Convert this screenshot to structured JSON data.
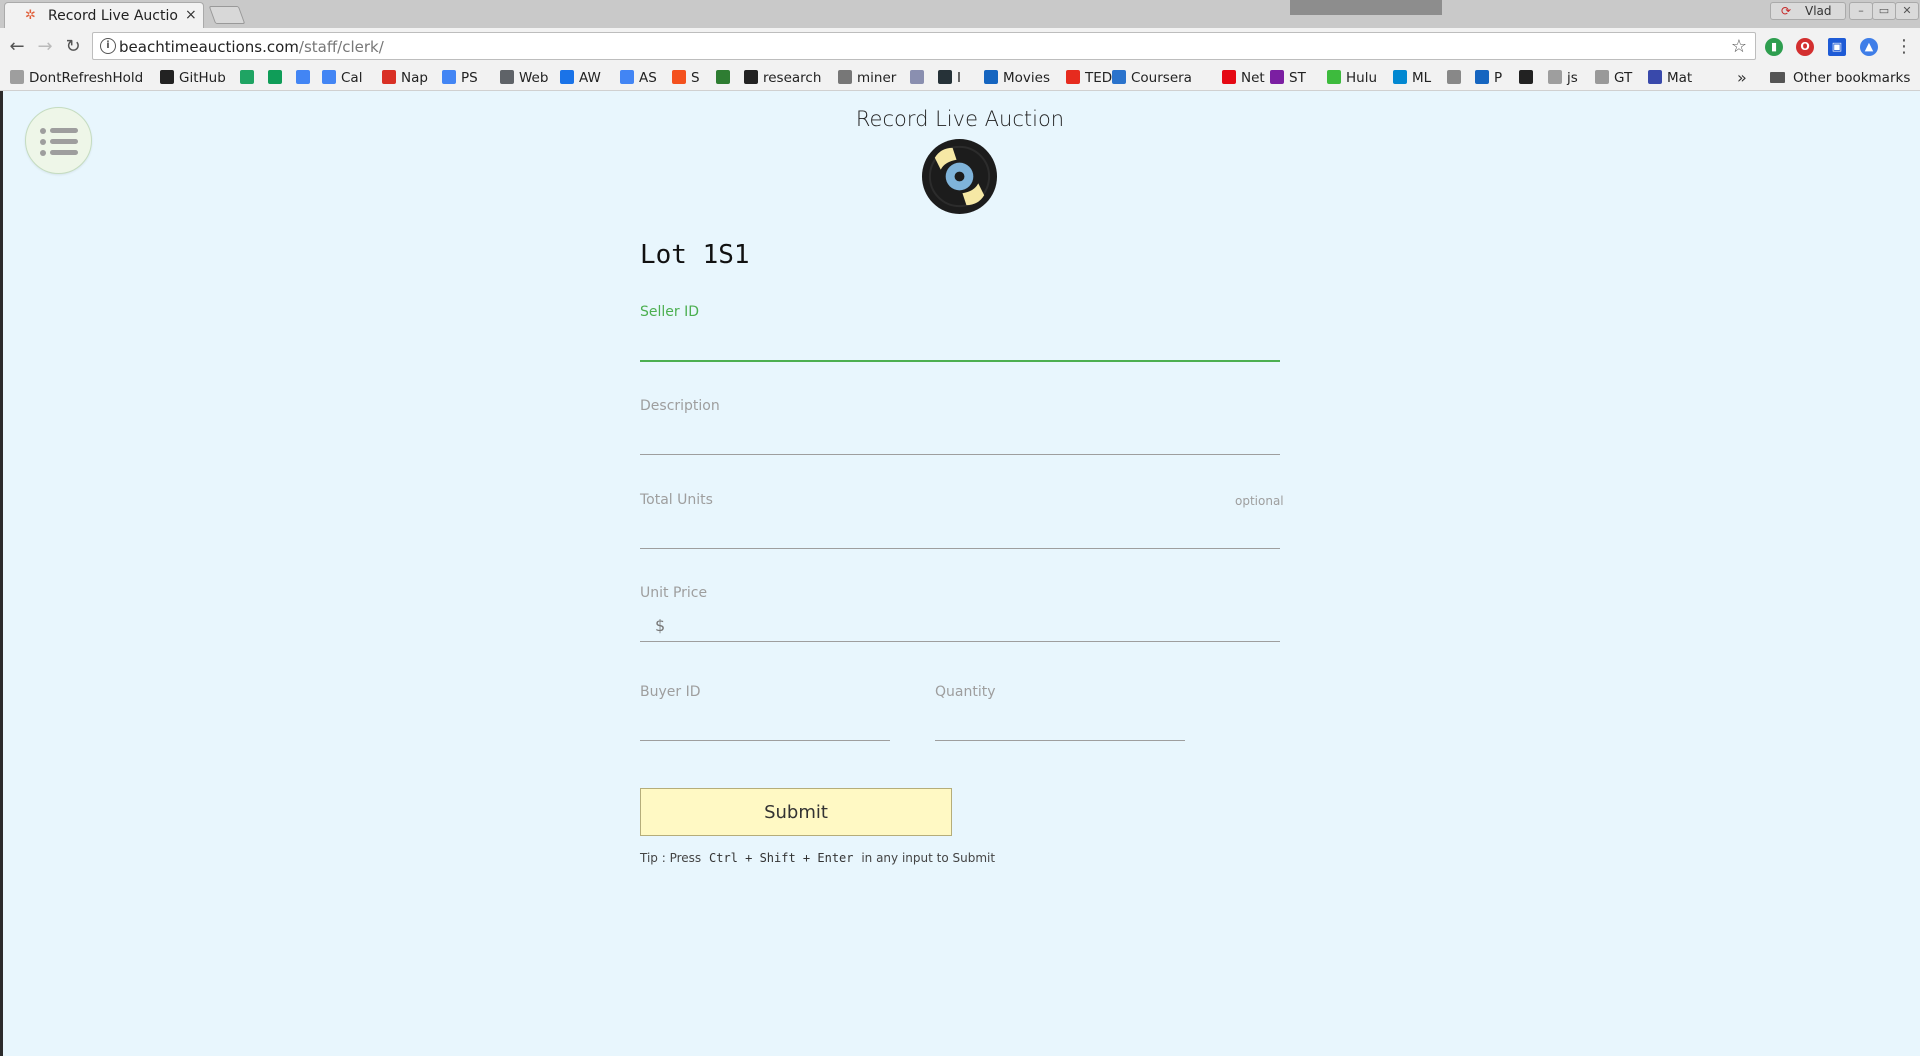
{
  "browser": {
    "tab_title": "Record Live Auction",
    "tab_close": "×",
    "user_name": "Vlad",
    "url_host": "beachtimeauctions.com",
    "url_path": "/staff/clerk/",
    "bookmarks": [
      {
        "label": "DontRefreshHold",
        "icon": "page-icon"
      },
      {
        "label": "GitHub",
        "icon": "github-icon"
      },
      {
        "label": "",
        "icon": "google-drive-icon"
      },
      {
        "label": "",
        "icon": "google-sheets-icon"
      },
      {
        "label": "",
        "icon": "google-docs-icon"
      },
      {
        "label": "Cal",
        "icon": "calendar-icon"
      },
      {
        "label": "Nap",
        "icon": "gmail-icon"
      },
      {
        "label": "PS",
        "icon": "google-icon"
      },
      {
        "label": "Web",
        "icon": "web-icon"
      },
      {
        "label": "AW",
        "icon": "adwords-icon"
      },
      {
        "label": "AS",
        "icon": "google-icon"
      },
      {
        "label": "S",
        "icon": "orange-circle-icon"
      },
      {
        "label": "",
        "icon": "gear-icon"
      },
      {
        "label": "research",
        "icon": "github-icon"
      },
      {
        "label": "miner",
        "icon": "pick-icon"
      },
      {
        "label": "",
        "icon": "circle-icon"
      },
      {
        "label": "I",
        "icon": "dark-square-icon"
      },
      {
        "label": "Movies",
        "icon": "movie-icon"
      },
      {
        "label": "TED",
        "icon": "ted-icon"
      },
      {
        "label": "Coursera",
        "icon": "coursera-icon"
      },
      {
        "label": "Net",
        "icon": "netflix-icon"
      },
      {
        "label": "ST",
        "icon": "brackets-icon"
      },
      {
        "label": "Hulu",
        "icon": "hulu-icon"
      },
      {
        "label": "ML",
        "icon": "k-icon"
      },
      {
        "label": "",
        "icon": "leaf-icon"
      },
      {
        "label": "P",
        "icon": "paypal-icon"
      },
      {
        "label": "",
        "icon": "z-icon"
      },
      {
        "label": "js",
        "icon": "page-icon"
      },
      {
        "label": "GT",
        "icon": "dash-icon"
      },
      {
        "label": "Mat",
        "icon": "shield-icon"
      }
    ],
    "bookmarks_more": "»",
    "other_bookmarks": "Other bookmarks"
  },
  "app": {
    "title": "Record Live Auction",
    "lot_title": "Lot 1S1"
  },
  "form": {
    "seller_id_label": "Seller ID",
    "seller_id_value": "",
    "description_label": "Description",
    "description_value": "",
    "total_units_label": "Total Units",
    "total_units_optional": "optional",
    "total_units_value": "",
    "unit_price_label": "Unit Price",
    "unit_price_prefix": "$",
    "unit_price_value": "",
    "buyer_id_label": "Buyer ID",
    "buyer_id_value": "",
    "quantity_label": "Quantity",
    "quantity_value": "",
    "submit_label": "Submit",
    "tip_prefix": "Tip : Press",
    "tip_keys": "Ctrl + Shift + Enter",
    "tip_suffix": "in any input to Submit"
  },
  "colors": {
    "page_bg": "#e8f6fd",
    "active_field": "#4caf50",
    "submit_bg": "#fff9c4"
  }
}
